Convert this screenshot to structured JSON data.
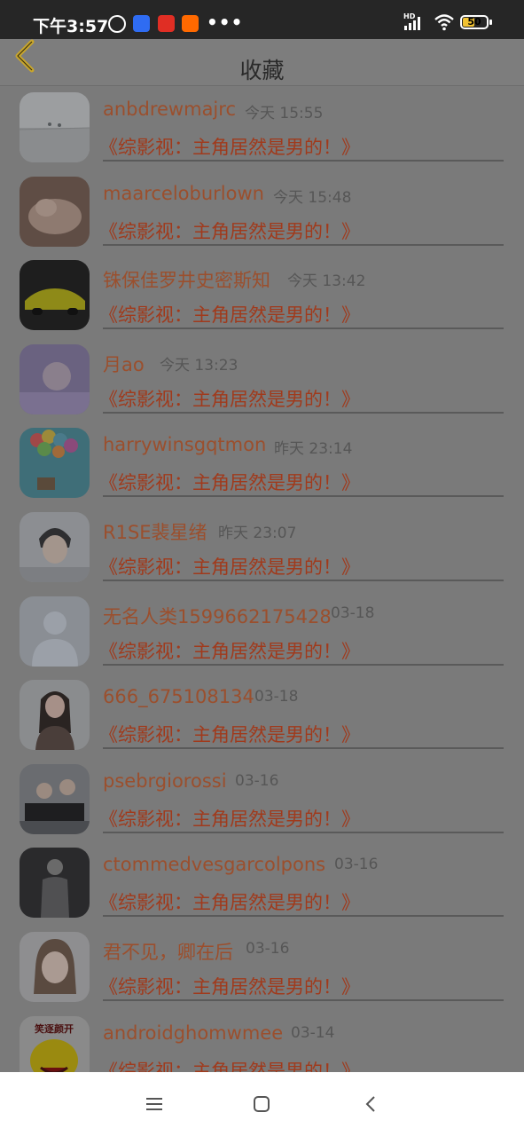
{
  "status_bar": {
    "time": "下午3:57",
    "battery": "50",
    "battery_level": 0.5,
    "network": "HD"
  },
  "header": {
    "title": "收藏"
  },
  "favorites": [
    {
      "name": "anbdrewmajrc",
      "time": "今天 15:55",
      "subtitle": "《综影视：主角居然是男的！》"
    },
    {
      "name": "maarceloburlown",
      "time": "今天 15:48",
      "subtitle": "《综影视：主角居然是男的！》"
    },
    {
      "name": "铢保佳罗井史密斯知",
      "time": "今天 13:42",
      "subtitle": "《综影视：主角居然是男的！》"
    },
    {
      "name": "月ao",
      "time": "今天 13:23",
      "subtitle": "《综影视：主角居然是男的！》"
    },
    {
      "name": "harrywinsgqtmon",
      "time": "昨天 23:14",
      "subtitle": "《综影视：主角居然是男的！》"
    },
    {
      "name": "R1SE裴星绪",
      "time": "昨天 23:07",
      "subtitle": "《综影视：主角居然是男的！》"
    },
    {
      "name": "无名人类1599662175428",
      "time": "03-18",
      "subtitle": "《综影视：主角居然是男的！》"
    },
    {
      "name": "666_675108134",
      "time": "03-18",
      "subtitle": "《综影视：主角居然是男的！》"
    },
    {
      "name": "psebrgiorossi",
      "time": "03-16",
      "subtitle": "《综影视：主角居然是男的！》"
    },
    {
      "name": "ctommedvesgarcolpons",
      "time": "03-16",
      "subtitle": "《综影视：主角居然是男的！》"
    },
    {
      "name": "君不见，卿在后",
      "time": "03-16",
      "subtitle": "《综影视：主角居然是男的！》"
    },
    {
      "name": "androidghomwmee",
      "time": "03-14",
      "subtitle": "《综影视：主角居然是男的！》"
    }
  ],
  "avatar_12_text": "笑逐颜开",
  "nav": {
    "menu": "menu-icon",
    "home": "home-icon",
    "back": "back-icon"
  }
}
